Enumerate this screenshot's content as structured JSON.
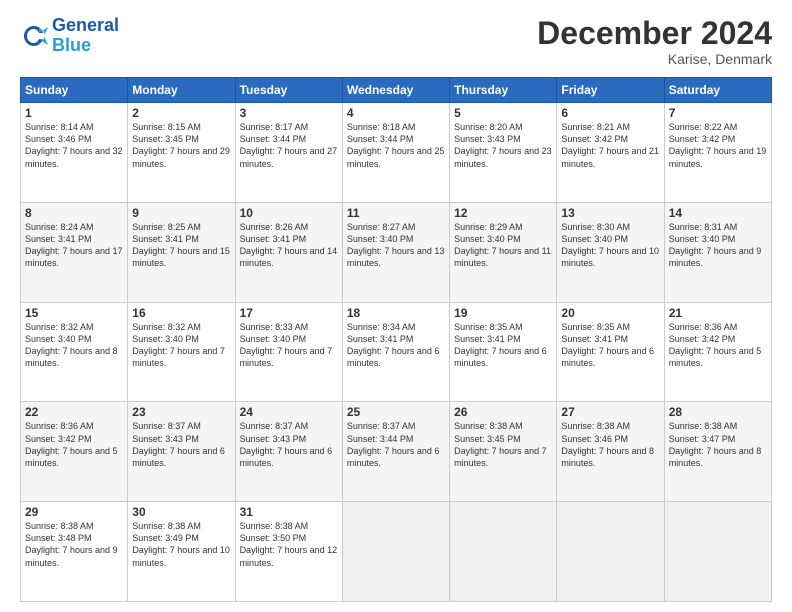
{
  "header": {
    "logo_line1": "General",
    "logo_line2": "Blue",
    "month_title": "December 2024",
    "location": "Karise, Denmark"
  },
  "weekdays": [
    "Sunday",
    "Monday",
    "Tuesday",
    "Wednesday",
    "Thursday",
    "Friday",
    "Saturday"
  ],
  "weeks": [
    [
      {
        "day": "1",
        "sunrise": "8:14 AM",
        "sunset": "3:46 PM",
        "daylight": "7 hours and 32 minutes."
      },
      {
        "day": "2",
        "sunrise": "8:15 AM",
        "sunset": "3:45 PM",
        "daylight": "7 hours and 29 minutes."
      },
      {
        "day": "3",
        "sunrise": "8:17 AM",
        "sunset": "3:44 PM",
        "daylight": "7 hours and 27 minutes."
      },
      {
        "day": "4",
        "sunrise": "8:18 AM",
        "sunset": "3:44 PM",
        "daylight": "7 hours and 25 minutes."
      },
      {
        "day": "5",
        "sunrise": "8:20 AM",
        "sunset": "3:43 PM",
        "daylight": "7 hours and 23 minutes."
      },
      {
        "day": "6",
        "sunrise": "8:21 AM",
        "sunset": "3:42 PM",
        "daylight": "7 hours and 21 minutes."
      },
      {
        "day": "7",
        "sunrise": "8:22 AM",
        "sunset": "3:42 PM",
        "daylight": "7 hours and 19 minutes."
      }
    ],
    [
      {
        "day": "8",
        "sunrise": "8:24 AM",
        "sunset": "3:41 PM",
        "daylight": "7 hours and 17 minutes."
      },
      {
        "day": "9",
        "sunrise": "8:25 AM",
        "sunset": "3:41 PM",
        "daylight": "7 hours and 15 minutes."
      },
      {
        "day": "10",
        "sunrise": "8:26 AM",
        "sunset": "3:41 PM",
        "daylight": "7 hours and 14 minutes."
      },
      {
        "day": "11",
        "sunrise": "8:27 AM",
        "sunset": "3:40 PM",
        "daylight": "7 hours and 13 minutes."
      },
      {
        "day": "12",
        "sunrise": "8:29 AM",
        "sunset": "3:40 PM",
        "daylight": "7 hours and 11 minutes."
      },
      {
        "day": "13",
        "sunrise": "8:30 AM",
        "sunset": "3:40 PM",
        "daylight": "7 hours and 10 minutes."
      },
      {
        "day": "14",
        "sunrise": "8:31 AM",
        "sunset": "3:40 PM",
        "daylight": "7 hours and 9 minutes."
      }
    ],
    [
      {
        "day": "15",
        "sunrise": "8:32 AM",
        "sunset": "3:40 PM",
        "daylight": "7 hours and 8 minutes."
      },
      {
        "day": "16",
        "sunrise": "8:32 AM",
        "sunset": "3:40 PM",
        "daylight": "7 hours and 7 minutes."
      },
      {
        "day": "17",
        "sunrise": "8:33 AM",
        "sunset": "3:40 PM",
        "daylight": "7 hours and 7 minutes."
      },
      {
        "day": "18",
        "sunrise": "8:34 AM",
        "sunset": "3:41 PM",
        "daylight": "7 hours and 6 minutes."
      },
      {
        "day": "19",
        "sunrise": "8:35 AM",
        "sunset": "3:41 PM",
        "daylight": "7 hours and 6 minutes."
      },
      {
        "day": "20",
        "sunrise": "8:35 AM",
        "sunset": "3:41 PM",
        "daylight": "7 hours and 6 minutes."
      },
      {
        "day": "21",
        "sunrise": "8:36 AM",
        "sunset": "3:42 PM",
        "daylight": "7 hours and 5 minutes."
      }
    ],
    [
      {
        "day": "22",
        "sunrise": "8:36 AM",
        "sunset": "3:42 PM",
        "daylight": "7 hours and 5 minutes."
      },
      {
        "day": "23",
        "sunrise": "8:37 AM",
        "sunset": "3:43 PM",
        "daylight": "7 hours and 6 minutes."
      },
      {
        "day": "24",
        "sunrise": "8:37 AM",
        "sunset": "3:43 PM",
        "daylight": "7 hours and 6 minutes."
      },
      {
        "day": "25",
        "sunrise": "8:37 AM",
        "sunset": "3:44 PM",
        "daylight": "7 hours and 6 minutes."
      },
      {
        "day": "26",
        "sunrise": "8:38 AM",
        "sunset": "3:45 PM",
        "daylight": "7 hours and 7 minutes."
      },
      {
        "day": "27",
        "sunrise": "8:38 AM",
        "sunset": "3:46 PM",
        "daylight": "7 hours and 8 minutes."
      },
      {
        "day": "28",
        "sunrise": "8:38 AM",
        "sunset": "3:47 PM",
        "daylight": "7 hours and 8 minutes."
      }
    ],
    [
      {
        "day": "29",
        "sunrise": "8:38 AM",
        "sunset": "3:48 PM",
        "daylight": "7 hours and 9 minutes."
      },
      {
        "day": "30",
        "sunrise": "8:38 AM",
        "sunset": "3:49 PM",
        "daylight": "7 hours and 10 minutes."
      },
      {
        "day": "31",
        "sunrise": "8:38 AM",
        "sunset": "3:50 PM",
        "daylight": "7 hours and 12 minutes."
      },
      null,
      null,
      null,
      null
    ]
  ]
}
